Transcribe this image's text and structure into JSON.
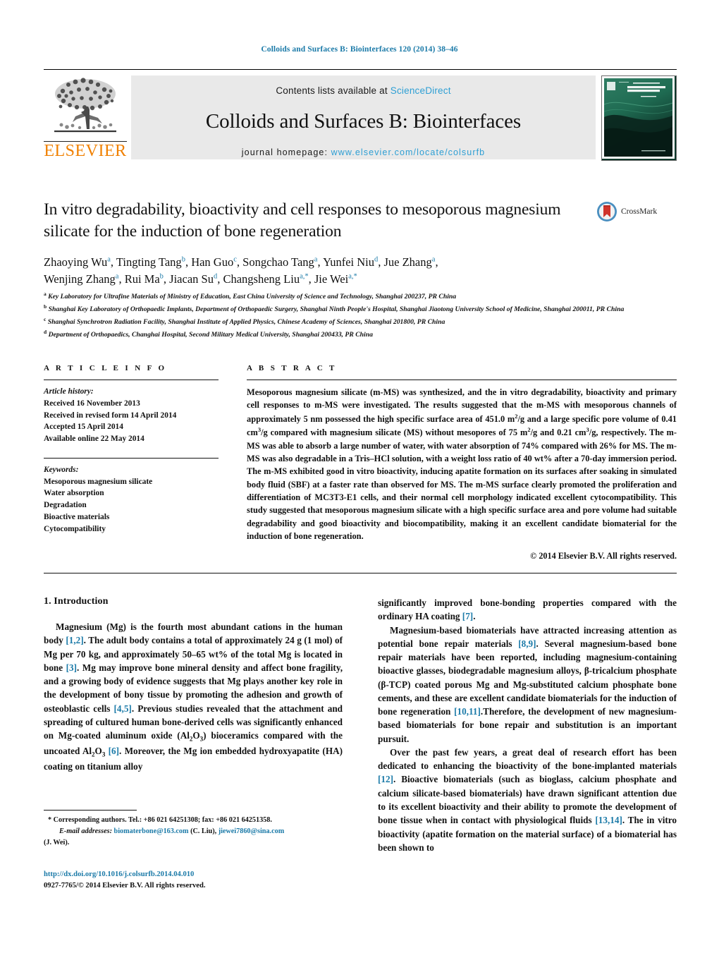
{
  "running_head": "Colloids and Surfaces B: Biointerfaces 120 (2014) 38–46",
  "masthead": {
    "publisher": "ELSEVIER",
    "contents_prefix": "Contents lists available at ",
    "contents_link": "ScienceDirect",
    "journal_title": "Colloids and Surfaces B: Biointerfaces",
    "homepage_prefix": "journal homepage: ",
    "homepage_url": "www.elsevier.com/locate/colsurfb",
    "cover_line1": "COLLOIDS AND",
    "cover_line2": "SURFACES B"
  },
  "crossmark": {
    "label": "CrossMark"
  },
  "article": {
    "title": "In vitro degradability, bioactivity and cell responses to mesoporous magnesium silicate for the induction of bone regeneration",
    "authors_line1": "Zhaoying Wu<sup>a</sup>, Tingting Tang<sup>b</sup>, Han Guo<sup>c</sup>, Songchao Tang<sup>a</sup>, Yunfei Niu<sup>d</sup>, Jue Zhang<sup>a</sup>,",
    "authors_line2": "Wenjing Zhang<sup>a</sup>, Rui Ma<sup>b</sup>, Jiacan Su<sup>d</sup>, Changsheng Liu<sup>a,<span class=\"star\">*</span></sup>, Jie Wei<sup>a,<span class=\"star\">*</span></sup>",
    "affiliations": [
      "<sup>a</sup> Key Laboratory for Ultrafine Materials of Ministry of Education, East China University of Science and Technology, Shanghai 200237, PR China",
      "<sup>b</sup> Shanghai Key Laboratory of Orthopaedic Implants, Department of Orthopaedic Surgery, Shanghai Ninth People's Hospital, Shanghai Jiaotong University School of Medicine, Shanghai 200011, PR China",
      "<sup>c</sup> Shanghai Synchrotron Radiation Facility, Shanghai Institute of Applied Physics, Chinese Academy of Sciences, Shanghai 201800, PR China",
      "<sup>d</sup> Department of Orthopaedics, Changhai Hospital, Second Military Medical University, Shanghai 200433, PR China"
    ]
  },
  "article_info": {
    "heading": "A R T I C L E  I N F O",
    "history_label": "Article history:",
    "history": [
      "Received 16 November 2013",
      "Received in revised form 14 April 2014",
      "Accepted 15 April 2014",
      "Available online 22 May 2014"
    ],
    "keywords_label": "Keywords:",
    "keywords": [
      "Mesoporous magnesium silicate",
      "Water absorption",
      "Degradation",
      "Bioactive materials",
      "Cytocompatibility"
    ]
  },
  "abstract": {
    "heading": "A B S T R A C T",
    "text": "Mesoporous magnesium silicate (m-MS) was synthesized, and the in vitro degradability, bioactivity and primary cell responses to m-MS were investigated. The results suggested that the m-MS with mesoporous channels of approximately 5 nm possessed the high specific surface area of 451.0 m<sup>2</sup>/g and a large specific pore volume of 0.41 cm<sup>3</sup>/g compared with magnesium silicate (MS) without mesopores of 75 m<sup>2</sup>/g and 0.21 cm<sup>3</sup>/g, respectively. The m-MS was able to absorb a large number of water, with water absorption of 74% compared with 26% for MS. The m-MS was also degradable in a Tris–HCl solution, with a weight loss ratio of 40 wt% after a 70-day immersion period. The m-MS exhibited good in vitro bioactivity, inducing apatite formation on its surfaces after soaking in simulated body fluid (SBF) at a faster rate than observed for MS. The m-MS surface clearly promoted the proliferation and differentiation of MC3T3-E1 cells, and their normal cell morphology indicated excellent cytocompatibility. This study suggested that mesoporous magnesium silicate with a high specific surface area and pore volume had suitable degradability and good bioactivity and biocompatibility, making it an excellent candidate biomaterial for the induction of bone regeneration.",
    "copyright": "© 2014 Elsevier B.V. All rights reserved."
  },
  "body": {
    "section_title": "1.  Introduction",
    "left_paragraphs": [
      "Magnesium (Mg) is the fourth most abundant cations in the human body <span class=\"ref\">[1,2]</span>. The adult body contains a total of approximately 24 g (1 mol) of Mg per 70 kg, and approximately 50–65 wt% of the total Mg is located in bone <span class=\"ref\">[3]</span>. Mg may improve bone mineral density and affect bone fragility, and a growing body of evidence suggests that Mg plays another key role in the development of bony tissue by promoting the adhesion and growth of osteoblastic cells <span class=\"ref\">[4,5]</span>. Previous studies revealed that the attachment and spreading of cultured human bone-derived cells was significantly enhanced on Mg-coated aluminum oxide (Al<sub>2</sub>O<sub>3</sub>) bioceramics compared with the uncoated Al<sub>2</sub>O<sub>3</sub> <span class=\"ref\">[6]</span>. Moreover, the Mg ion embedded hydroxyapatite (HA) coating on titanium alloy"
    ],
    "right_paragraphs": [
      "significantly improved bone-bonding properties compared with the ordinary HA coating <span class=\"ref\">[7]</span>.",
      "Magnesium-based biomaterials have attracted increasing attention as potential bone repair materials <span class=\"ref\">[8,9]</span>. Several magnesium-based bone repair materials have been reported, including magnesium-containing bioactive glasses, biodegradable magnesium alloys, β-tricalcium phosphate (β-TCP) coated porous Mg and Mg-substituted calcium phosphate bone cements, and these are excellent candidate biomaterials for the induction of bone regeneration <span class=\"ref\">[10,11]</span>.Therefore, the development of new magnesium-based biomaterials for bone repair and substitution is an important pursuit.",
      "Over the past few years, a great deal of research effort has been dedicated to enhancing the bioactivity of the bone-implanted materials <span class=\"ref\">[12]</span>. Bioactive biomaterials (such as bioglass, calcium phosphate and calcium silicate-based biomaterials) have drawn significant attention due to its excellent bioactivity and their ability to promote the development of bone tissue when in contact with physiological fluids <span class=\"ref\">[13,14]</span>. The in vitro bioactivity (apatite formation on the material surface) of a biomaterial has been shown to"
    ]
  },
  "footnote": {
    "corresponding": "*  Corresponding authors. Tel.: +86 021 64251308; fax: +86 021 64251358.",
    "email_label": "E-mail addresses:",
    "email1": "biomaterbone@163.com",
    "email1_owner": "(C. Liu),",
    "email2": "jiewei7860@sina.com",
    "email2_owner": "(J. Wei).",
    "doi": "http://dx.doi.org/10.1016/j.colsurfb.2014.04.010",
    "issn_line": "0927-7765/© 2014 Elsevier B.V. All rights reserved."
  }
}
